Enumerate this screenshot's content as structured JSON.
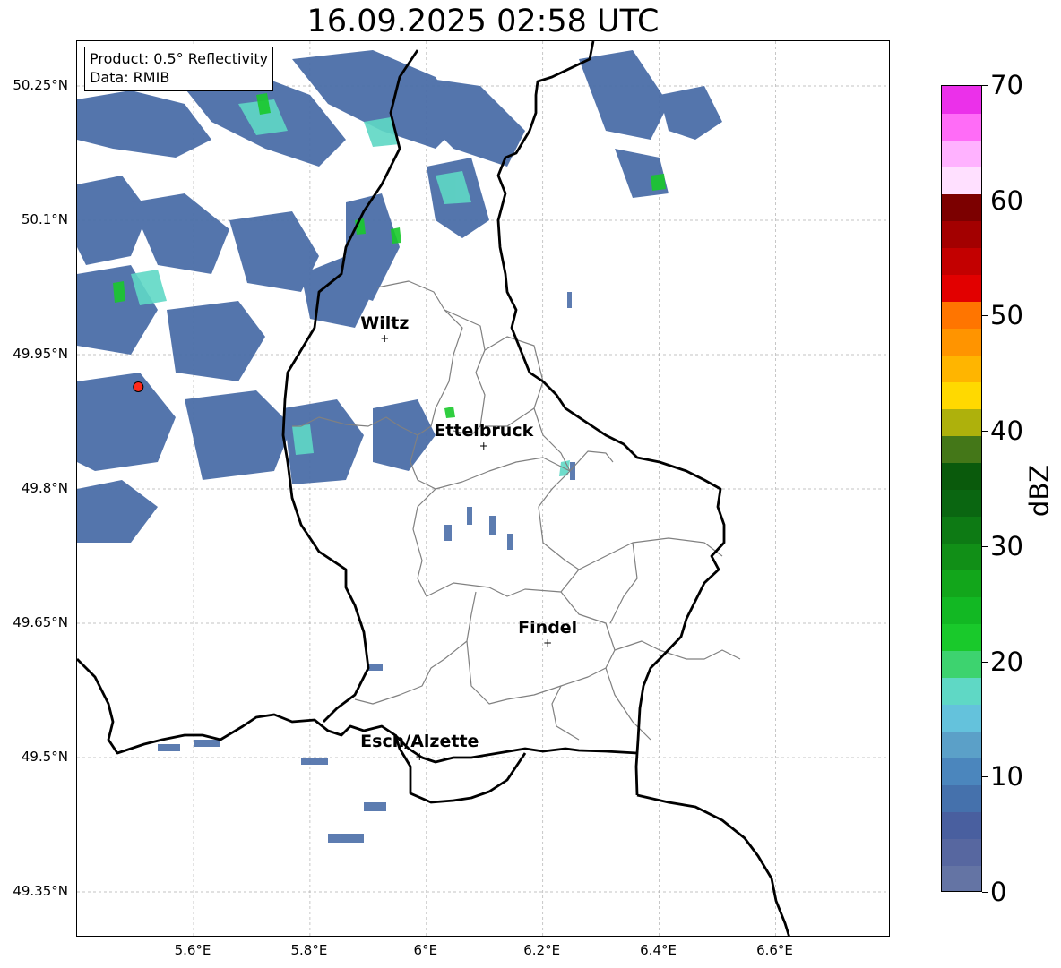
{
  "title": "16.09.2025 02:58 UTC",
  "info_box": {
    "product": "Product: 0.5° Reflectivity",
    "data": "Data: RMIB"
  },
  "axes": {
    "lon_labels": [
      "5.6°E",
      "5.8°E",
      "6°E",
      "6.2°E",
      "6.4°E",
      "6.6°E"
    ],
    "lat_labels": [
      "50.25°N",
      "50.1°N",
      "49.95°N",
      "49.8°N",
      "49.65°N",
      "49.5°N",
      "49.35°N"
    ]
  },
  "cities": [
    {
      "name": "Wiltz",
      "lon": 5.93,
      "lat": 49.967
    },
    {
      "name": "Ettelbruck",
      "lon": 6.1,
      "lat": 49.847
    },
    {
      "name": "Findel",
      "lon": 6.21,
      "lat": 49.627
    },
    {
      "name": "Esch/Alzette",
      "lon": 5.99,
      "lat": 49.5
    }
  ],
  "radar_site": {
    "lon": 5.505,
    "lat": 49.914,
    "color": "#ff2a1a"
  },
  "colorbar": {
    "title": "dBZ",
    "tick_labels": [
      "0",
      "10",
      "20",
      "30",
      "40",
      "50",
      "60",
      "70"
    ],
    "vmin": 0,
    "vmax": 70,
    "colors": [
      "#6474a4",
      "#5767a0",
      "#495f9f",
      "#4571ac",
      "#4b86bd",
      "#5ba0c8",
      "#64c2dc",
      "#5fd8c5",
      "#3dd36f",
      "#19c92b",
      "#12b823",
      "#12a61b",
      "#118f17",
      "#0d7a14",
      "#0a6611",
      "#0a5a0c",
      "#447718",
      "#aeb10c",
      "#ffd900",
      "#ffb500",
      "#ff9400",
      "#ff7500",
      "#e20000",
      "#c30000",
      "#a30000",
      "#7c0000",
      "#ffe0ff",
      "#ffb2ff",
      "#ff6cf7",
      "#eb30ea"
    ]
  },
  "colors": {
    "border": "#000000",
    "canton_lines": "#808080",
    "grid": "#b0b0b0"
  }
}
